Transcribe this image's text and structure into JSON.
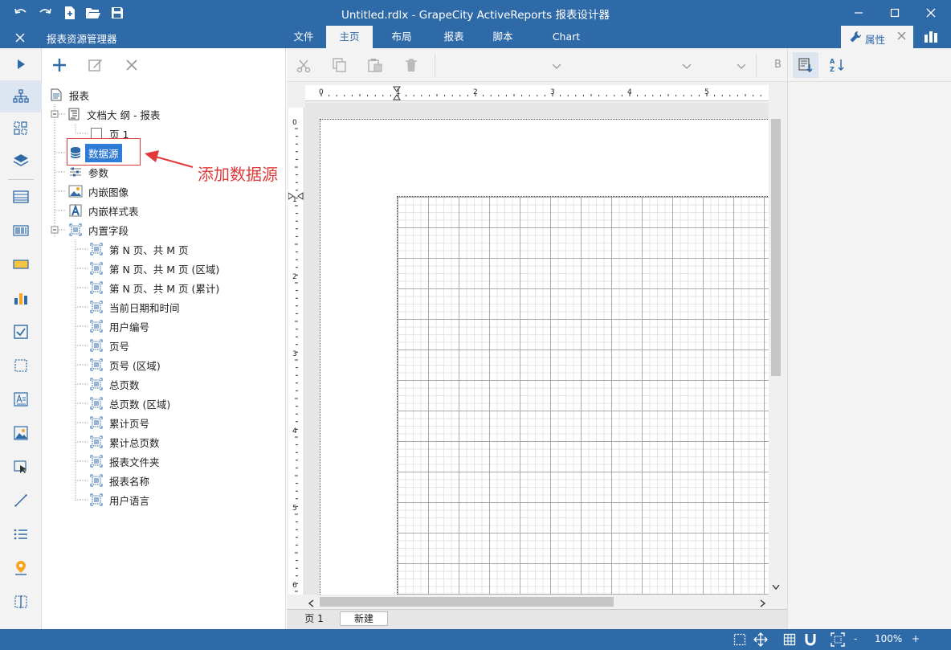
{
  "window": {
    "title": "Untitled.rdlx - GrapeCity ActiveReports 报表设计器"
  },
  "ribbon": {
    "panel_title": "报表资源管理器",
    "tabs": [
      {
        "label": "文件",
        "active": false
      },
      {
        "label": "主页",
        "active": true
      },
      {
        "label": "布局",
        "active": false
      },
      {
        "label": "报表",
        "active": false
      },
      {
        "label": "脚本",
        "active": false
      },
      {
        "label": "Chart",
        "active": false
      }
    ],
    "properties_tab": "属性"
  },
  "explorer": {
    "tree": {
      "root": "报表",
      "outline": "文档大 纲 - 报表",
      "page": "页 1",
      "datasource": "数据源",
      "parameters": "参数",
      "embedded_images": "内嵌图像",
      "embedded_styles": "内嵌样式表",
      "common_values": "内置字段",
      "common_items": [
        "第 N 页、共 M 页",
        "第 N 页、共 M 页 (区域)",
        "第 N 页、共 M 页 (累计)",
        "当前日期和时间",
        "用户编号",
        "页号",
        "页号 (区域)",
        "总页数",
        "总页数 (区域)",
        "累计页号",
        "累计总页数",
        "报表文件夹",
        "报表名称",
        "用户语言"
      ]
    }
  },
  "annotation": {
    "text": "添加数据源",
    "color": "#e03a3a"
  },
  "designer": {
    "toolbar_bold": "B",
    "ruler_h": [
      "0",
      "1",
      "2",
      "3",
      "4",
      "5"
    ],
    "ruler_v": [
      "0",
      "1",
      "2",
      "3",
      "4",
      "5",
      "6"
    ],
    "page_tabs": [
      "页 1",
      "新建"
    ]
  },
  "status": {
    "zoom": "100%",
    "minus": "-",
    "plus": "+"
  },
  "colors": {
    "accent": "#2f6aa8",
    "selection": "#2f7bd8"
  }
}
